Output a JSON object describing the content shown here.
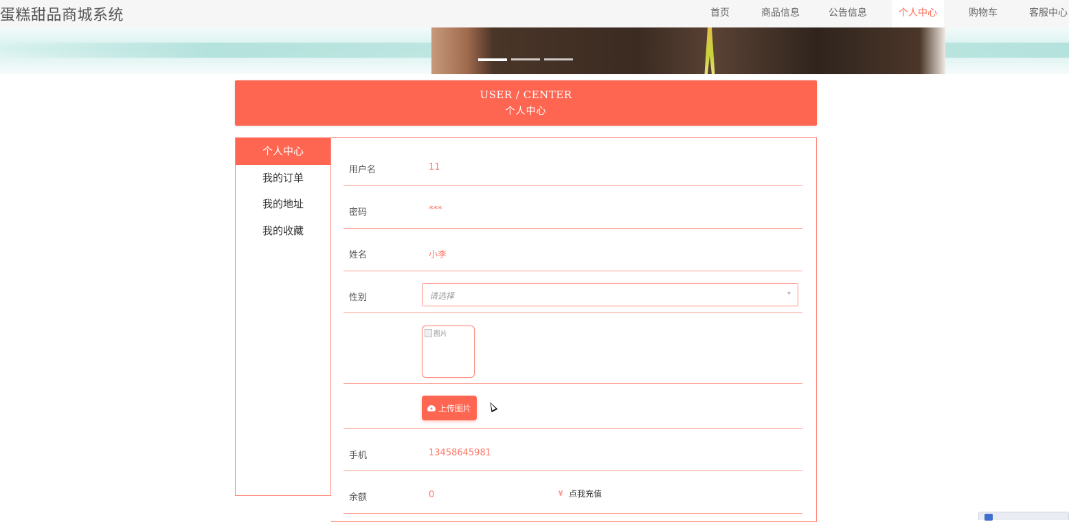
{
  "app": {
    "title": "蛋糕甜品商城系统"
  },
  "nav": {
    "items": [
      {
        "label": "首页"
      },
      {
        "label": "商品信息"
      },
      {
        "label": "公告信息"
      },
      {
        "label": "个人中心"
      },
      {
        "label": "购物车"
      },
      {
        "label": "客服中心"
      }
    ],
    "active_index": 3
  },
  "banner": {
    "slides": 3,
    "active_slide": 0
  },
  "header": {
    "title_en": "USER / CENTER",
    "title_cn": "个人中心"
  },
  "sidebar": {
    "items": [
      {
        "label": "个人中心"
      },
      {
        "label": "我的订单"
      },
      {
        "label": "我的地址"
      },
      {
        "label": "我的收藏"
      }
    ],
    "active_index": 0
  },
  "form": {
    "username": {
      "label": "用户名",
      "value": "11"
    },
    "password": {
      "label": "密码",
      "value": "***"
    },
    "name": {
      "label": "姓名",
      "value": "小李"
    },
    "gender": {
      "label": "性别",
      "placeholder": "请选择"
    },
    "avatar": {
      "alt": "图片"
    },
    "upload": {
      "label": "上传图片"
    },
    "phone": {
      "label": "手机",
      "value": "13458645981"
    },
    "balance": {
      "label": "余额",
      "value": "0",
      "recharge_label": "点我充值",
      "currency_symbol": "¥"
    }
  },
  "colors": {
    "accent": "#ff6652",
    "border": "#ff8a7d",
    "nav_bg": "#f6f6f6"
  },
  "icons": {
    "upload": "cloud-upload-icon",
    "recharge": "yen-icon",
    "select": "chevron-down-icon"
  }
}
